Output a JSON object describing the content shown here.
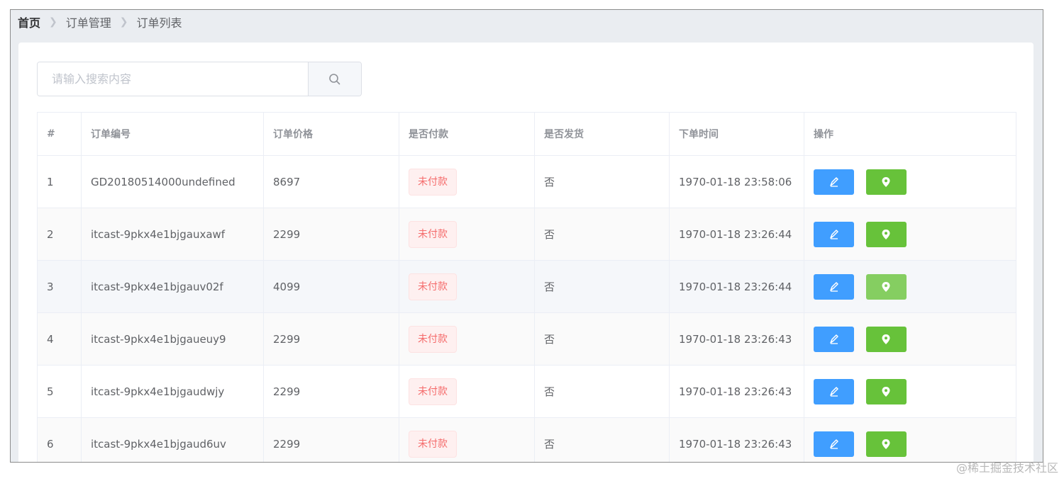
{
  "breadcrumb": {
    "items": [
      "首页",
      "订单管理",
      "订单列表"
    ]
  },
  "search": {
    "placeholder": "请输入搜索内容",
    "button_icon": "search-icon"
  },
  "table": {
    "headers": [
      "#",
      "订单编号",
      "订单价格",
      "是否付款",
      "是否发货",
      "下单时间",
      "操作"
    ],
    "rows": [
      {
        "index": "1",
        "order_no": "GD20180514000undefined",
        "price": "8697",
        "paid": "未付款",
        "shipped": "否",
        "time": "1970-01-18 23:58:06"
      },
      {
        "index": "2",
        "order_no": "itcast-9pkx4e1bjgauxawf",
        "price": "2299",
        "paid": "未付款",
        "shipped": "否",
        "time": "1970-01-18 23:26:44"
      },
      {
        "index": "3",
        "order_no": "itcast-9pkx4e1bjgauv02f",
        "price": "4099",
        "paid": "未付款",
        "shipped": "否",
        "time": "1970-01-18 23:26:44"
      },
      {
        "index": "4",
        "order_no": "itcast-9pkx4e1bjgaueuy9",
        "price": "2299",
        "paid": "未付款",
        "shipped": "否",
        "time": "1970-01-18 23:26:43"
      },
      {
        "index": "5",
        "order_no": "itcast-9pkx4e1bjgaudwjy",
        "price": "2299",
        "paid": "未付款",
        "shipped": "否",
        "time": "1970-01-18 23:26:43"
      },
      {
        "index": "6",
        "order_no": "itcast-9pkx4e1bjgaud6uv",
        "price": "2299",
        "paid": "未付款",
        "shipped": "否",
        "time": "1970-01-18 23:26:43"
      }
    ]
  },
  "actions": {
    "edit_icon": "edit-icon",
    "location_icon": "location-icon"
  },
  "colors": {
    "primary": "#409eff",
    "success": "#67c23a",
    "danger": "#f56c6c"
  },
  "watermark": "@稀土掘金技术社区"
}
